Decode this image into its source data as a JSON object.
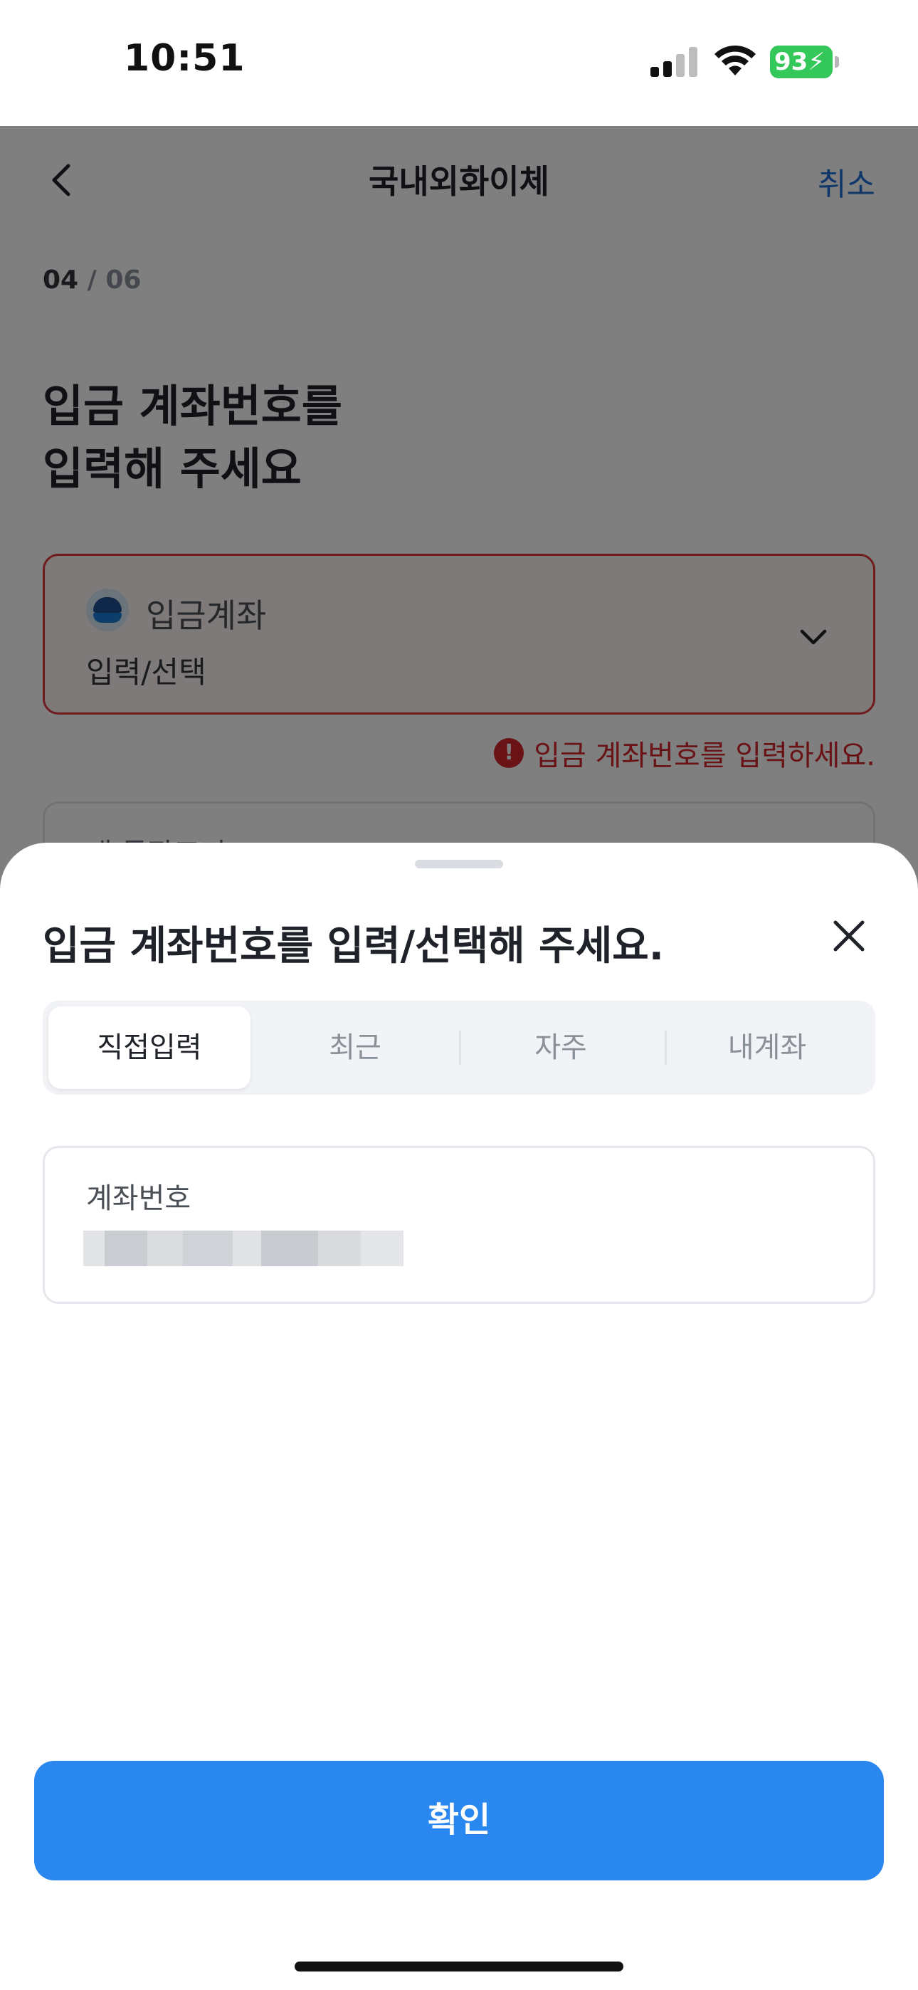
{
  "status_bar": {
    "time": "10:51",
    "battery_level": "93",
    "battery_color": "#34c759"
  },
  "nav": {
    "title": "국내외화이체",
    "cancel_label": "취소",
    "back_icon": "chevron-left-icon"
  },
  "step": {
    "current": "04",
    "separator": "/",
    "total": "06"
  },
  "headline": {
    "line1": "입금 계좌번호를",
    "line2": "입력해 주세요"
  },
  "account_field": {
    "label": "입금계좌",
    "placeholder": "입력/선택",
    "bank_icon": "bank-logo-icon",
    "chevron_icon": "chevron-down-icon",
    "border_color": "#e0383e"
  },
  "error": {
    "icon": "!",
    "message": "입금 계좌번호를 입력하세요.",
    "color": "#d5262e"
  },
  "memo_field": {
    "label": "내 통장표기"
  },
  "sheet": {
    "title": "입금 계좌번호를 입력/선택해 주세요.",
    "close_icon": "close-icon",
    "tabs": [
      {
        "label": "직접입력",
        "active": true
      },
      {
        "label": "최근",
        "active": false
      },
      {
        "label": "자주",
        "active": false
      },
      {
        "label": "내계좌",
        "active": false
      }
    ],
    "input": {
      "label": "계좌번호",
      "value_state": "blurred"
    },
    "confirm_label": "확인",
    "confirm_color": "#2a87ef"
  }
}
